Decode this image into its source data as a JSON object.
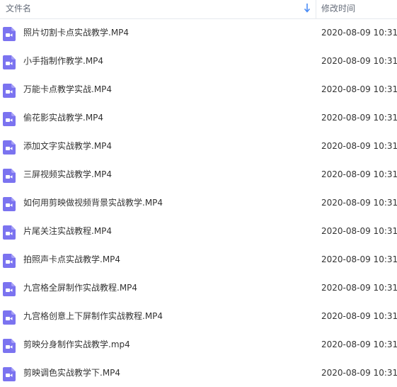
{
  "header": {
    "name_label": "文件名",
    "time_label": "修改时间",
    "sort_icon": "arrow-down-icon"
  },
  "colors": {
    "accent": "#4a8bf5",
    "file_icon": "#7b73f0"
  },
  "files": [
    {
      "name": "照片切割卡点实战教学.MP4",
      "time": "2020-08-09 10:31",
      "icon": "video-file-icon"
    },
    {
      "name": "小手指制作教学.MP4",
      "time": "2020-08-09 10:31",
      "icon": "video-file-icon"
    },
    {
      "name": "万能卡点教学实战.MP4",
      "time": "2020-08-09 10:31",
      "icon": "video-file-icon"
    },
    {
      "name": "偷花影实战教学.MP4",
      "time": "2020-08-09 10:31",
      "icon": "video-file-icon"
    },
    {
      "name": "添加文字实战教学.MP4",
      "time": "2020-08-09 10:31",
      "icon": "video-file-icon"
    },
    {
      "name": "三屏视频实战教学.MP4",
      "time": "2020-08-09 10:31",
      "icon": "video-file-icon"
    },
    {
      "name": "如何用剪映做视频背景实战教学.MP4",
      "time": "2020-08-09 10:31",
      "icon": "video-file-icon"
    },
    {
      "name": "片尾关注实战教程.MP4",
      "time": "2020-08-09 10:31",
      "icon": "video-file-icon"
    },
    {
      "name": "拍照声卡点实战教学.MP4",
      "time": "2020-08-09 10:31",
      "icon": "video-file-icon"
    },
    {
      "name": "九宫格全屏制作实战教程.MP4",
      "time": "2020-08-09 10:31",
      "icon": "video-file-icon"
    },
    {
      "name": "九宫格创意上下屏制作实战教程.MP4",
      "time": "2020-08-09 10:31",
      "icon": "video-file-icon"
    },
    {
      "name": "剪映分身制作实战教学.mp4",
      "time": "2020-08-09 10:31",
      "icon": "video-file-icon"
    },
    {
      "name": "剪映调色实战教学下.MP4",
      "time": "2020-08-09 10:31",
      "icon": "video-file-icon"
    }
  ]
}
